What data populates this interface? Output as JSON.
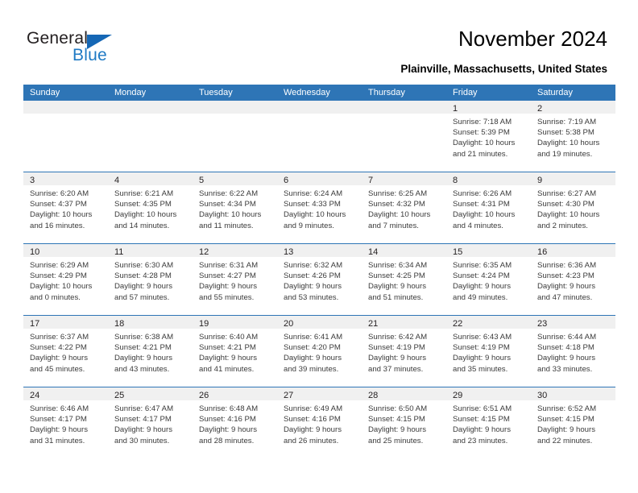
{
  "brand": {
    "name_top": "General",
    "name_bottom": "Blue",
    "accent_color": "#1f7ac4",
    "triangle_color": "#1567b5"
  },
  "header": {
    "title": "November 2024",
    "subtitle": "Plainville, Massachusetts, United States"
  },
  "calendar": {
    "header_color": "#2e75b6",
    "weekdays": [
      "Sunday",
      "Monday",
      "Tuesday",
      "Wednesday",
      "Thursday",
      "Friday",
      "Saturday"
    ],
    "weeks": [
      [
        {
          "date": "",
          "lines": [
            "",
            "",
            "",
            ""
          ]
        },
        {
          "date": "",
          "lines": [
            "",
            "",
            "",
            ""
          ]
        },
        {
          "date": "",
          "lines": [
            "",
            "",
            "",
            ""
          ]
        },
        {
          "date": "",
          "lines": [
            "",
            "",
            "",
            ""
          ]
        },
        {
          "date": "",
          "lines": [
            "",
            "",
            "",
            ""
          ]
        },
        {
          "date": "1",
          "lines": [
            "Sunrise: 7:18 AM",
            "Sunset: 5:39 PM",
            "Daylight: 10 hours",
            "and 21 minutes."
          ]
        },
        {
          "date": "2",
          "lines": [
            "Sunrise: 7:19 AM",
            "Sunset: 5:38 PM",
            "Daylight: 10 hours",
            "and 19 minutes."
          ]
        }
      ],
      [
        {
          "date": "3",
          "lines": [
            "Sunrise: 6:20 AM",
            "Sunset: 4:37 PM",
            "Daylight: 10 hours",
            "and 16 minutes."
          ]
        },
        {
          "date": "4",
          "lines": [
            "Sunrise: 6:21 AM",
            "Sunset: 4:35 PM",
            "Daylight: 10 hours",
            "and 14 minutes."
          ]
        },
        {
          "date": "5",
          "lines": [
            "Sunrise: 6:22 AM",
            "Sunset: 4:34 PM",
            "Daylight: 10 hours",
            "and 11 minutes."
          ]
        },
        {
          "date": "6",
          "lines": [
            "Sunrise: 6:24 AM",
            "Sunset: 4:33 PM",
            "Daylight: 10 hours",
            "and 9 minutes."
          ]
        },
        {
          "date": "7",
          "lines": [
            "Sunrise: 6:25 AM",
            "Sunset: 4:32 PM",
            "Daylight: 10 hours",
            "and 7 minutes."
          ]
        },
        {
          "date": "8",
          "lines": [
            "Sunrise: 6:26 AM",
            "Sunset: 4:31 PM",
            "Daylight: 10 hours",
            "and 4 minutes."
          ]
        },
        {
          "date": "9",
          "lines": [
            "Sunrise: 6:27 AM",
            "Sunset: 4:30 PM",
            "Daylight: 10 hours",
            "and 2 minutes."
          ]
        }
      ],
      [
        {
          "date": "10",
          "lines": [
            "Sunrise: 6:29 AM",
            "Sunset: 4:29 PM",
            "Daylight: 10 hours",
            "and 0 minutes."
          ]
        },
        {
          "date": "11",
          "lines": [
            "Sunrise: 6:30 AM",
            "Sunset: 4:28 PM",
            "Daylight: 9 hours",
            "and 57 minutes."
          ]
        },
        {
          "date": "12",
          "lines": [
            "Sunrise: 6:31 AM",
            "Sunset: 4:27 PM",
            "Daylight: 9 hours",
            "and 55 minutes."
          ]
        },
        {
          "date": "13",
          "lines": [
            "Sunrise: 6:32 AM",
            "Sunset: 4:26 PM",
            "Daylight: 9 hours",
            "and 53 minutes."
          ]
        },
        {
          "date": "14",
          "lines": [
            "Sunrise: 6:34 AM",
            "Sunset: 4:25 PM",
            "Daylight: 9 hours",
            "and 51 minutes."
          ]
        },
        {
          "date": "15",
          "lines": [
            "Sunrise: 6:35 AM",
            "Sunset: 4:24 PM",
            "Daylight: 9 hours",
            "and 49 minutes."
          ]
        },
        {
          "date": "16",
          "lines": [
            "Sunrise: 6:36 AM",
            "Sunset: 4:23 PM",
            "Daylight: 9 hours",
            "and 47 minutes."
          ]
        }
      ],
      [
        {
          "date": "17",
          "lines": [
            "Sunrise: 6:37 AM",
            "Sunset: 4:22 PM",
            "Daylight: 9 hours",
            "and 45 minutes."
          ]
        },
        {
          "date": "18",
          "lines": [
            "Sunrise: 6:38 AM",
            "Sunset: 4:21 PM",
            "Daylight: 9 hours",
            "and 43 minutes."
          ]
        },
        {
          "date": "19",
          "lines": [
            "Sunrise: 6:40 AM",
            "Sunset: 4:21 PM",
            "Daylight: 9 hours",
            "and 41 minutes."
          ]
        },
        {
          "date": "20",
          "lines": [
            "Sunrise: 6:41 AM",
            "Sunset: 4:20 PM",
            "Daylight: 9 hours",
            "and 39 minutes."
          ]
        },
        {
          "date": "21",
          "lines": [
            "Sunrise: 6:42 AM",
            "Sunset: 4:19 PM",
            "Daylight: 9 hours",
            "and 37 minutes."
          ]
        },
        {
          "date": "22",
          "lines": [
            "Sunrise: 6:43 AM",
            "Sunset: 4:19 PM",
            "Daylight: 9 hours",
            "and 35 minutes."
          ]
        },
        {
          "date": "23",
          "lines": [
            "Sunrise: 6:44 AM",
            "Sunset: 4:18 PM",
            "Daylight: 9 hours",
            "and 33 minutes."
          ]
        }
      ],
      [
        {
          "date": "24",
          "lines": [
            "Sunrise: 6:46 AM",
            "Sunset: 4:17 PM",
            "Daylight: 9 hours",
            "and 31 minutes."
          ]
        },
        {
          "date": "25",
          "lines": [
            "Sunrise: 6:47 AM",
            "Sunset: 4:17 PM",
            "Daylight: 9 hours",
            "and 30 minutes."
          ]
        },
        {
          "date": "26",
          "lines": [
            "Sunrise: 6:48 AM",
            "Sunset: 4:16 PM",
            "Daylight: 9 hours",
            "and 28 minutes."
          ]
        },
        {
          "date": "27",
          "lines": [
            "Sunrise: 6:49 AM",
            "Sunset: 4:16 PM",
            "Daylight: 9 hours",
            "and 26 minutes."
          ]
        },
        {
          "date": "28",
          "lines": [
            "Sunrise: 6:50 AM",
            "Sunset: 4:15 PM",
            "Daylight: 9 hours",
            "and 25 minutes."
          ]
        },
        {
          "date": "29",
          "lines": [
            "Sunrise: 6:51 AM",
            "Sunset: 4:15 PM",
            "Daylight: 9 hours",
            "and 23 minutes."
          ]
        },
        {
          "date": "30",
          "lines": [
            "Sunrise: 6:52 AM",
            "Sunset: 4:15 PM",
            "Daylight: 9 hours",
            "and 22 minutes."
          ]
        }
      ]
    ]
  }
}
